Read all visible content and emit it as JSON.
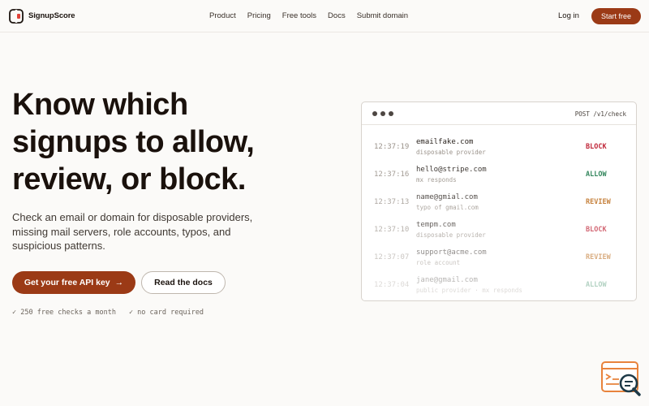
{
  "nav": {
    "brand": "SignupScore",
    "links": [
      "Product",
      "Pricing",
      "Free tools",
      "Docs",
      "Submit domain"
    ],
    "login": "Log in",
    "start": "Start free"
  },
  "hero": {
    "title_lines": [
      "Know which",
      "signups to allow,",
      "review, or block."
    ],
    "subtitle": "Check an email or domain for disposable providers, missing mail servers, role accounts, typos, and suspicious patterns.",
    "cta_primary": "Get your free API key",
    "cta_primary_arrow": "→",
    "cta_secondary": "Read the docs",
    "perks": [
      "✓ 250 free checks a month",
      "✓ no card required"
    ]
  },
  "panel": {
    "endpoint": "POST /v1/check",
    "rows": [
      {
        "time": "12:37:19",
        "email": "emailfake.com",
        "reason": "disposable provider",
        "verdict": "BLOCK"
      },
      {
        "time": "12:37:16",
        "email": "hello@stripe.com",
        "reason": "mx responds",
        "verdict": "ALLOW"
      },
      {
        "time": "12:37:13",
        "email": "name@gmial.com",
        "reason": "typo of gmail.com",
        "verdict": "REVIEW"
      },
      {
        "time": "12:37:10",
        "email": "tempm.com",
        "reason": "disposable provider",
        "verdict": "BLOCK"
      },
      {
        "time": "12:37:07",
        "email": "support@acme.com",
        "reason": "role account",
        "verdict": "REVIEW"
      },
      {
        "time": "12:37:04",
        "email": "jane@gmail.com",
        "reason": "public provider · mx responds",
        "verdict": "ALLOW"
      }
    ]
  },
  "colors": {
    "accent": "#9b3a16",
    "block": "#c0283a",
    "allow": "#1e7a4c",
    "review": "#b8640f"
  },
  "icons": [
    "logo-icon",
    "arrow-right-icon",
    "check-icon",
    "window-dots-icon",
    "chat-search-icon"
  ]
}
